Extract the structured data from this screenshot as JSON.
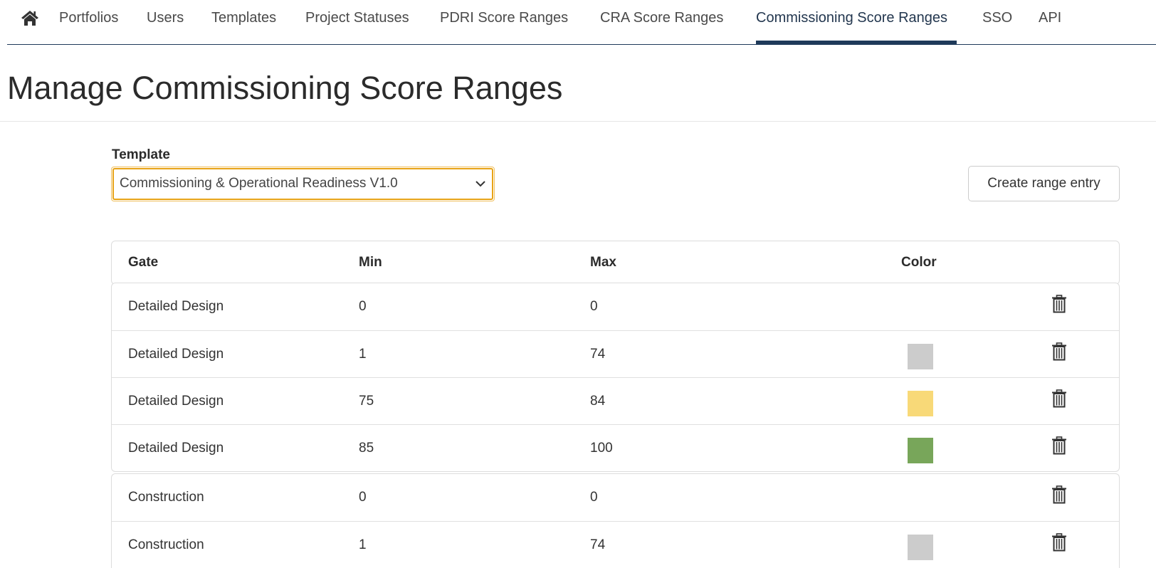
{
  "nav": {
    "home_icon": "home-icon",
    "items": [
      {
        "label": "Portfolios",
        "active": false
      },
      {
        "label": "Users",
        "active": false
      },
      {
        "label": "Templates",
        "active": false
      },
      {
        "label": "Project Statuses",
        "active": false
      },
      {
        "label": "PDRI Score Ranges",
        "active": false
      },
      {
        "label": "CRA Score Ranges",
        "active": false
      },
      {
        "label": "Commissioning Score Ranges",
        "active": true
      },
      {
        "label": "SSO",
        "active": false
      },
      {
        "label": "API",
        "active": false
      }
    ]
  },
  "page": {
    "title": "Manage Commissioning Score Ranges"
  },
  "template_select": {
    "label": "Template",
    "value": "Commissioning & Operational Readiness V1.0"
  },
  "create_button": {
    "label": "Create range entry"
  },
  "table": {
    "headers": {
      "gate": "Gate",
      "min": "Min",
      "max": "Max",
      "color": "Color"
    },
    "groups": [
      {
        "rows": [
          {
            "gate": "Detailed Design",
            "min": "0",
            "max": "0",
            "color": null
          },
          {
            "gate": "Detailed Design",
            "min": "1",
            "max": "74",
            "color": "#cccccc"
          },
          {
            "gate": "Detailed Design",
            "min": "75",
            "max": "84",
            "color": "#f8d978"
          },
          {
            "gate": "Detailed Design",
            "min": "85",
            "max": "100",
            "color": "#78a65a"
          }
        ]
      },
      {
        "rows": [
          {
            "gate": "Construction",
            "min": "0",
            "max": "0",
            "color": null
          },
          {
            "gate": "Construction",
            "min": "1",
            "max": "74",
            "color": "#cccccc"
          }
        ]
      }
    ],
    "delete_icon": "trash-icon"
  },
  "colors": {
    "nav_active": "#1f3a5a",
    "select_focus": "#e8a317"
  }
}
